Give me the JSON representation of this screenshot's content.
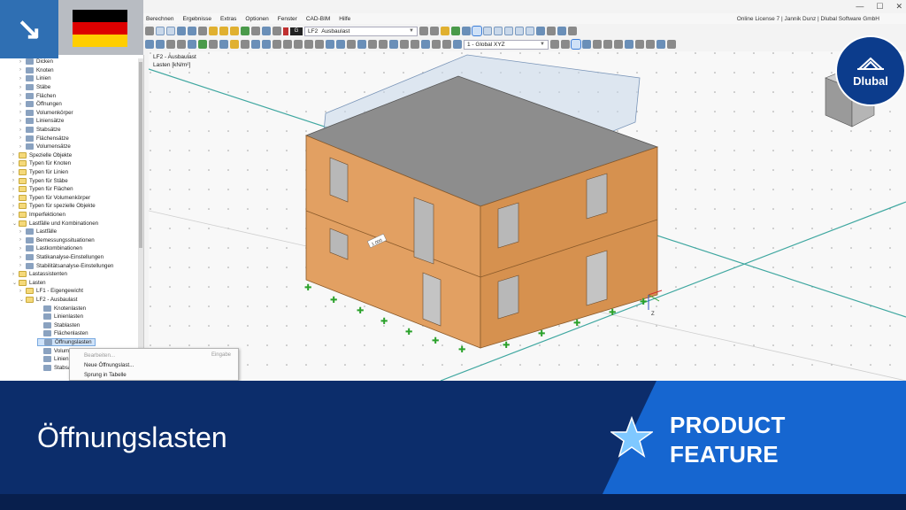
{
  "menubar": {
    "items": [
      "Berechnen",
      "Ergebnisse",
      "Extras",
      "Optionen",
      "Fenster",
      "CAD-BIM",
      "Hilfe"
    ],
    "license": "Online License 7 | Jannik Dunz | Dlubal Software GmbH"
  },
  "toolbar": {
    "load_case_code": "G",
    "load_case_id": "LF2",
    "load_case_name": "Ausbaulast",
    "coord_system": "1 - Global XYZ"
  },
  "window_controls": {
    "minimize": "—",
    "maximize": "☐",
    "close": "✕"
  },
  "sidebar": {
    "items": [
      {
        "label": "Dicken",
        "level": 3,
        "icon": "item"
      },
      {
        "label": "Knoten",
        "level": 3,
        "icon": "item"
      },
      {
        "label": "Linien",
        "level": 3,
        "icon": "item"
      },
      {
        "label": "Stäbe",
        "level": 3,
        "icon": "item"
      },
      {
        "label": "Flächen",
        "level": 3,
        "icon": "item"
      },
      {
        "label": "Öffnungen",
        "level": 3,
        "icon": "item"
      },
      {
        "label": "Volumenkörper",
        "level": 3,
        "icon": "item"
      },
      {
        "label": "Liniensätze",
        "level": 3,
        "icon": "item"
      },
      {
        "label": "Stabsätze",
        "level": 3,
        "icon": "item"
      },
      {
        "label": "Flächensätze",
        "level": 3,
        "icon": "item"
      },
      {
        "label": "Volumensätze",
        "level": 3,
        "icon": "item"
      },
      {
        "label": "Spezielle Objekte",
        "level": 2,
        "icon": "folder"
      },
      {
        "label": "Typen für Knoten",
        "level": 2,
        "icon": "folder"
      },
      {
        "label": "Typen für Linien",
        "level": 2,
        "icon": "folder"
      },
      {
        "label": "Typen für Stäbe",
        "level": 2,
        "icon": "folder"
      },
      {
        "label": "Typen für Flächen",
        "level": 2,
        "icon": "folder"
      },
      {
        "label": "Typen für Volumenkörper",
        "level": 2,
        "icon": "folder"
      },
      {
        "label": "Typen für spezielle Objekte",
        "level": 2,
        "icon": "folder"
      },
      {
        "label": "Imperfektionen",
        "level": 2,
        "icon": "folder"
      },
      {
        "label": "Lastfälle und Kombinationen",
        "level": 2,
        "icon": "folder",
        "expanded": true
      },
      {
        "label": "Lastfälle",
        "level": 3,
        "icon": "item"
      },
      {
        "label": "Bemessungssituationen",
        "level": 3,
        "icon": "item"
      },
      {
        "label": "Lastkombinationen",
        "level": 3,
        "icon": "item"
      },
      {
        "label": "Statikanalyse-Einstellungen",
        "level": 3,
        "icon": "item"
      },
      {
        "label": "Stabilitätsanalyse-Einstellungen",
        "level": 3,
        "icon": "item"
      },
      {
        "label": "Lastassistenten",
        "level": 2,
        "icon": "folder"
      },
      {
        "label": "Lasten",
        "level": 2,
        "icon": "folder",
        "expanded": true
      },
      {
        "label": "LF1 - Eigengewicht",
        "level": 3,
        "icon": "folder"
      },
      {
        "label": "LF2 - Ausbaulast",
        "level": 3,
        "icon": "folder",
        "expanded": true
      },
      {
        "label": "Knotenlasten",
        "level": 4,
        "icon": "item"
      },
      {
        "label": "Linienlasten",
        "level": 4,
        "icon": "item"
      },
      {
        "label": "Stablasten",
        "level": 4,
        "icon": "item"
      },
      {
        "label": "Flächenlasten",
        "level": 4,
        "icon": "item"
      },
      {
        "label": "Öffnungslasten",
        "level": 4,
        "icon": "item",
        "selected": true
      },
      {
        "label": "Volum",
        "level": 4,
        "icon": "item"
      },
      {
        "label": "Linien",
        "level": 4,
        "icon": "item"
      },
      {
        "label": "Stabsa",
        "level": 4,
        "icon": "item"
      }
    ]
  },
  "context_menu": {
    "edit": "Bearbeiten...",
    "edit_shortcut": "Eingabe",
    "new_opening_load": "Neue Öffnungslast...",
    "jump_to_table": "Sprung in Tabelle"
  },
  "viewport": {
    "load_case_label": "LF2 - Ausbaulast",
    "unit_label": "Lasten [kN/m²]",
    "dimension_tag": "1.000",
    "axis_z": "Z"
  },
  "brand": {
    "logo_text": "Dlubal",
    "flag_colors": [
      "#000000",
      "#dd0000",
      "#ffce00"
    ],
    "accent": "#1666d0",
    "dark": "#0c2d6b"
  },
  "banner": {
    "title": "Öffnungslasten",
    "feature_line1": "PRODUCT",
    "feature_line2": "FEATURE"
  }
}
